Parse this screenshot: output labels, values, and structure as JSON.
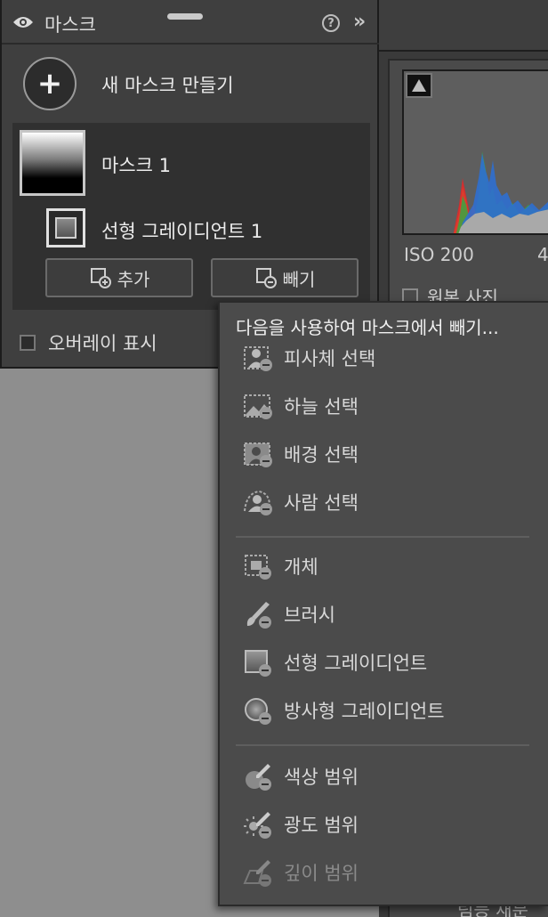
{
  "panel": {
    "title": "마스크",
    "help_label": "?",
    "collapse_label": "»",
    "new_mask_label": "새 마스크 만들기",
    "masks": [
      {
        "name": "마스크 1",
        "components": [
          {
            "name": "선형 그레이디언트 1"
          }
        ]
      }
    ],
    "add_label": "추가",
    "subtract_label": "빼기",
    "overlay_label": "오버레이 표시"
  },
  "histogram": {
    "iso": "ISO 200",
    "iso_extra": "4",
    "original_photo_label": "원본 사진"
  },
  "right_bottom_text": "림등 재분",
  "menu": {
    "header": "다음을 사용하여 마스크에서 빼기...",
    "groups": [
      [
        {
          "label": "피사체 선택",
          "icon": "subject-select-icon"
        },
        {
          "label": "하늘 선택",
          "icon": "sky-select-icon"
        },
        {
          "label": "배경 선택",
          "icon": "background-select-icon"
        },
        {
          "label": "사람 선택",
          "icon": "people-select-icon"
        }
      ],
      [
        {
          "label": "개체",
          "icon": "object-icon"
        },
        {
          "label": "브러시",
          "icon": "brush-icon"
        },
        {
          "label": "선형 그레이디언트",
          "icon": "linear-gradient-icon"
        },
        {
          "label": "방사형 그레이디언트",
          "icon": "radial-gradient-icon"
        }
      ],
      [
        {
          "label": "색상 범위",
          "icon": "color-range-icon"
        },
        {
          "label": "광도 범위",
          "icon": "luminance-range-icon"
        },
        {
          "label": "깊이 범위",
          "icon": "depth-range-icon",
          "disabled": true
        }
      ]
    ]
  }
}
